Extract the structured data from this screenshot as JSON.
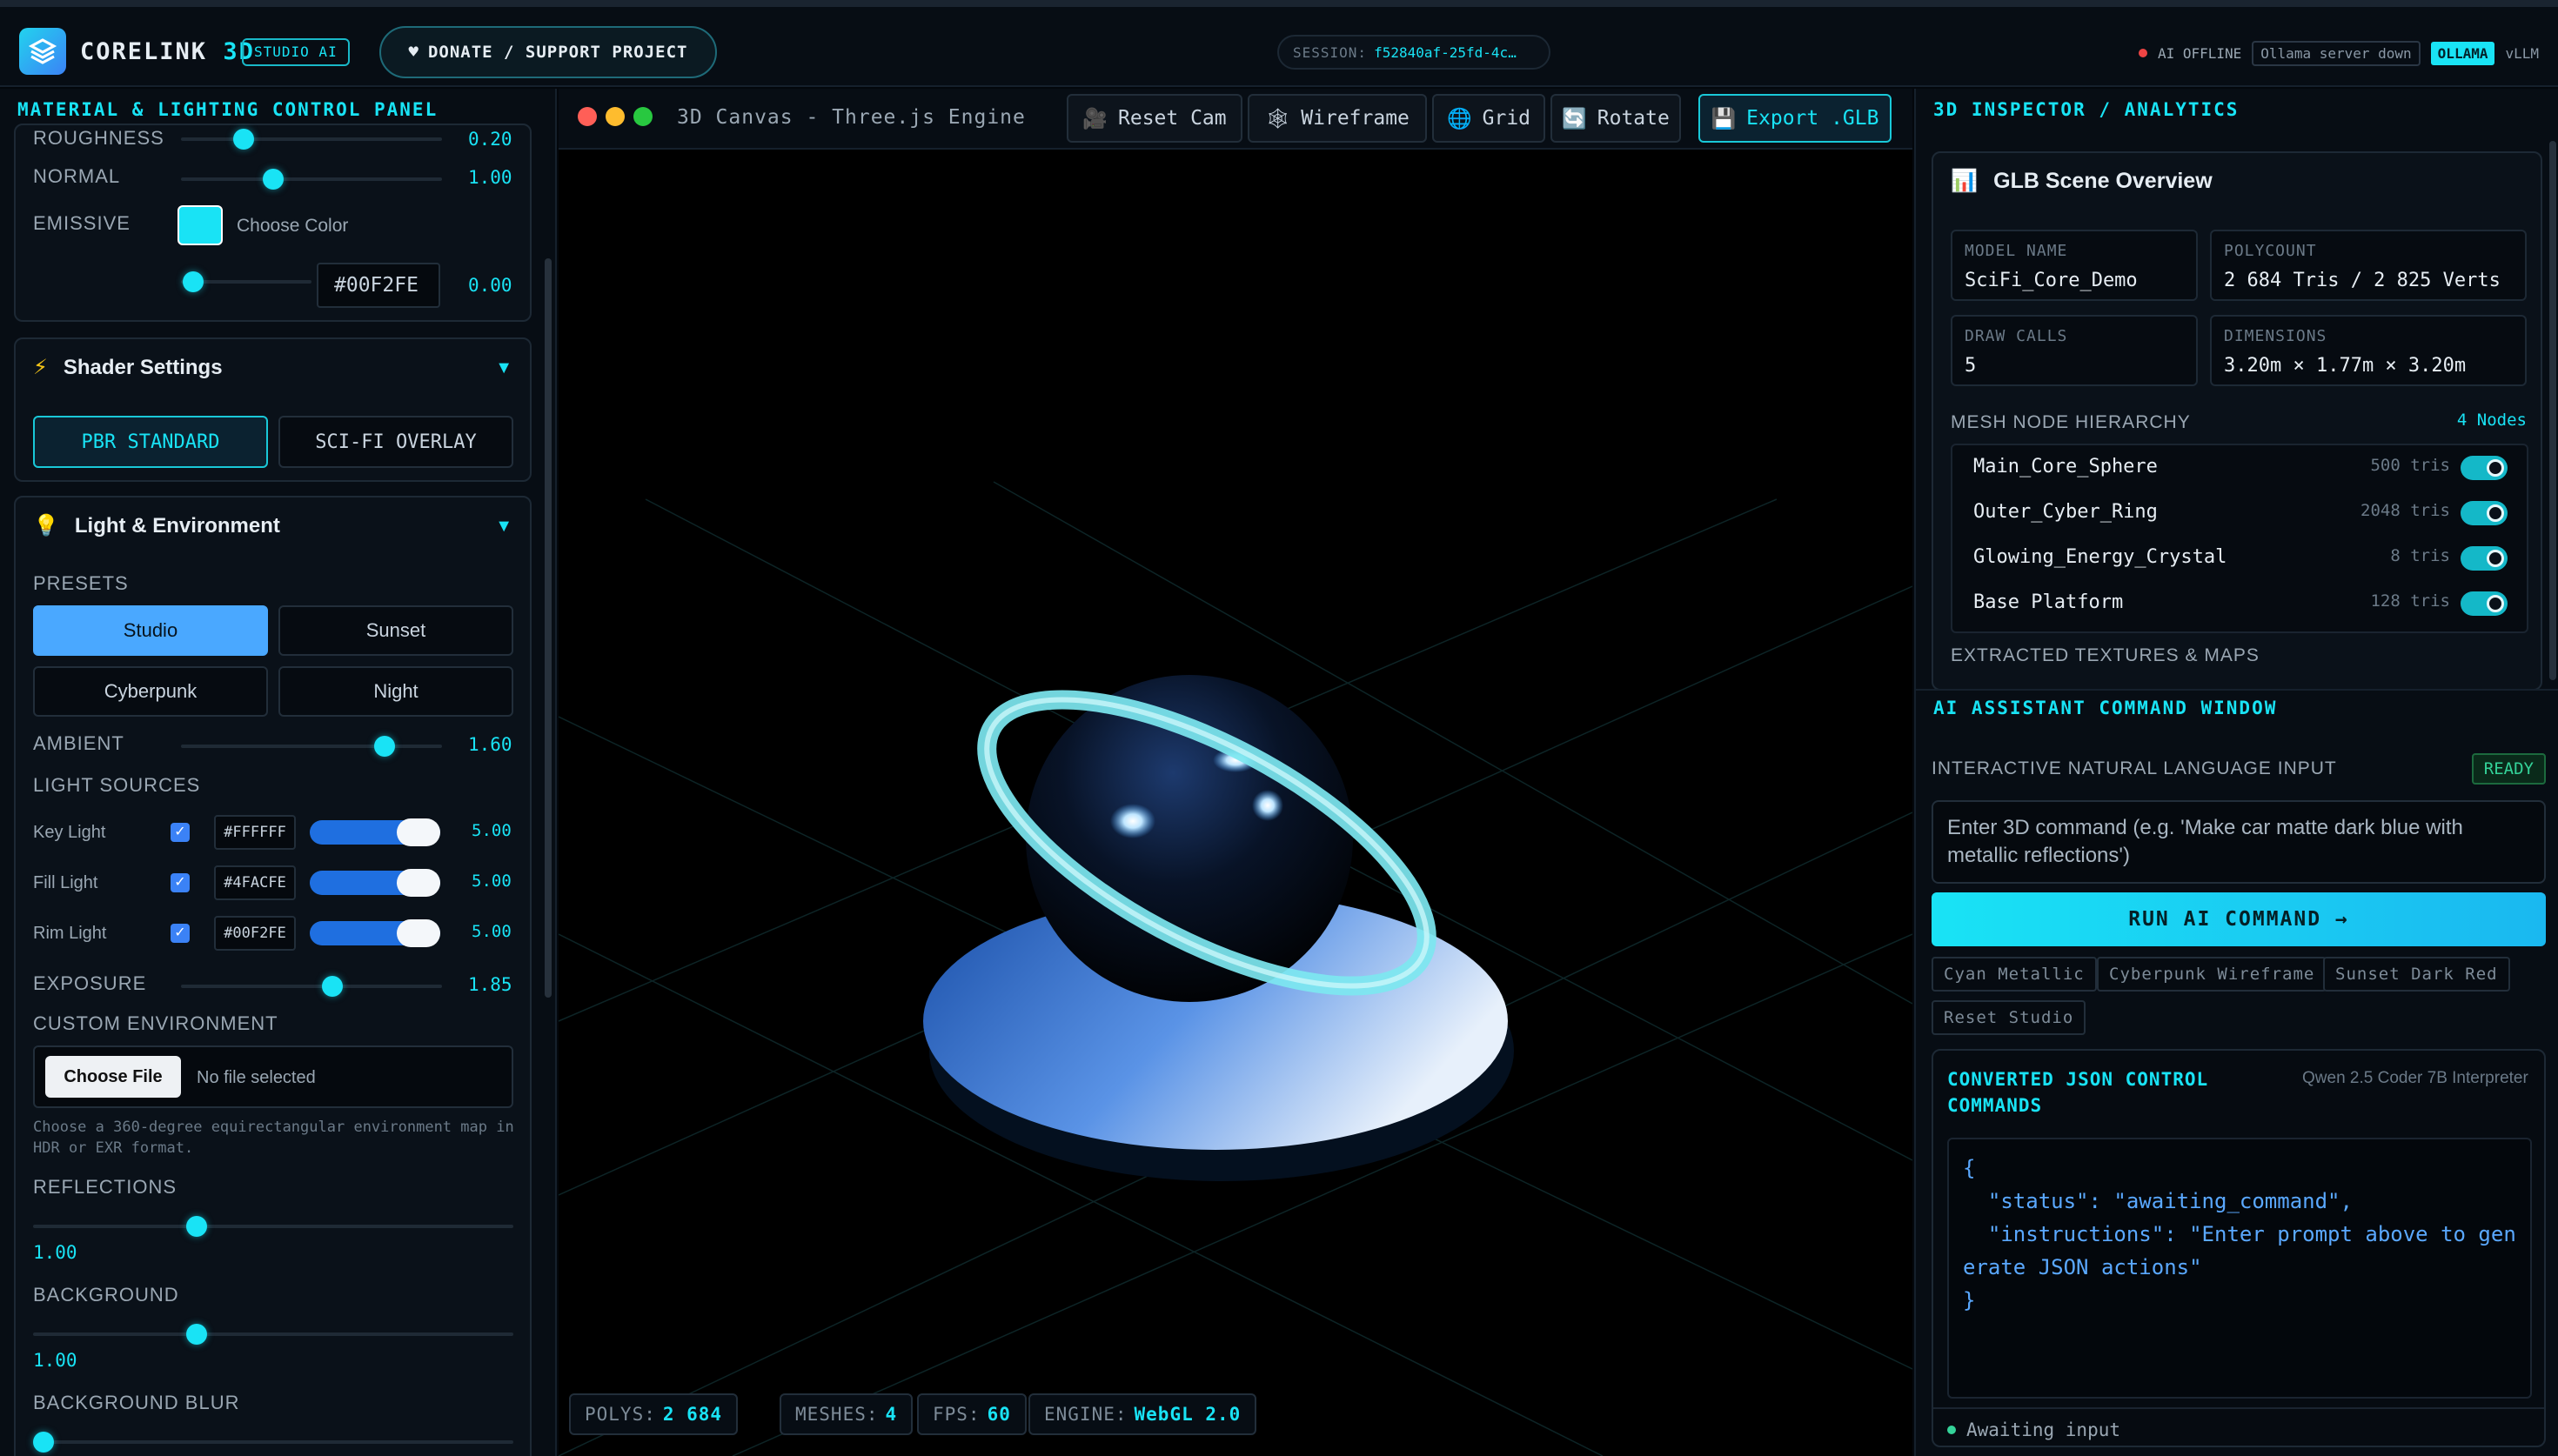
{
  "app": {
    "name_a": "CORELINK",
    "name_b": "3D",
    "badge": "STUDIO AI",
    "donate": "DONATE / SUPPORT PROJECT",
    "heart": "♥"
  },
  "session": {
    "label": "SESSION:",
    "value": "f52840af-25fd-4c…"
  },
  "status": {
    "ai": "AI OFFLINE",
    "note": "Ollama server down",
    "ollama": "OLLAMA",
    "vllm": "vLLM",
    "dot_color": "#ef4444"
  },
  "left": {
    "title": "MATERIAL & LIGHTING CONTROL PANEL",
    "material": {
      "roughness_label": "ROUGHNESS",
      "roughness_value": "0.20",
      "normal_label": "NORMAL",
      "normal_value": "1.00",
      "normal_level": 0.35,
      "emissive_label": "EMISSIVE",
      "choose_color": "Choose Color",
      "emissive_hex": "#00F2FE",
      "emissive_value": "0.00",
      "emissive_color": "#19e3f5"
    },
    "shader": {
      "title": "Shader Settings",
      "icon": "⚡",
      "opt1": "PBR STANDARD",
      "opt2": "SCI-FI OVERLAY"
    },
    "light": {
      "title": "Light & Environment",
      "icon": "💡",
      "presets_label": "PRESETS",
      "presets": [
        "Studio",
        "Sunset",
        "Cyberpunk",
        "Night"
      ],
      "ambient_label": "AMBIENT",
      "ambient_value": "1.60",
      "sources_label": "LIGHT SOURCES",
      "sources": [
        {
          "name": "Key Light",
          "hex": "#FFFFFF",
          "value": "5.00"
        },
        {
          "name": "Fill Light",
          "hex": "#4FACFE",
          "value": "5.00"
        },
        {
          "name": "Rim Light",
          "hex": "#00F2FE",
          "value": "5.00"
        }
      ],
      "exposure_label": "EXPOSURE",
      "exposure_value": "1.85",
      "custom_env_label": "CUSTOM ENVIRONMENT",
      "choose_file": "Choose File",
      "no_file": "No file selected",
      "env_note": "Choose a 360-degree equirectangular environment map in HDR or EXR format.",
      "reflections_label": "REFLECTIONS",
      "reflections_value": "1.00",
      "background_label": "BACKGROUND",
      "background_value": "1.00",
      "blur_label": "BACKGROUND BLUR"
    }
  },
  "canvas": {
    "title": "3D Canvas - Three.js Engine",
    "buttons": {
      "reset": "Reset Cam",
      "wireframe": "Wireframe",
      "grid": "Grid",
      "rotate": "Rotate",
      "export": "Export .GLB"
    },
    "stats": {
      "polys_label": "POLYS:",
      "polys": "2 684",
      "meshes_label": "MESHES:",
      "meshes": "4",
      "fps_label": "FPS:",
      "fps": "60",
      "engine_label": "ENGINE:",
      "engine": "WebGL 2.0"
    }
  },
  "right": {
    "title": "3D INSPECTOR / ANALYTICS",
    "overview_title": "GLB Scene Overview",
    "model_name_label": "MODEL NAME",
    "model_name": "SciFi_Core_Demo",
    "polycount_label": "POLYCOUNT",
    "polycount": "2 684 Tris / 2 825 Verts",
    "draw_calls_label": "DRAW CALLS",
    "draw_calls": "5",
    "dimensions_label": "DIMENSIONS",
    "dimensions": "3.20m × 1.77m × 3.20m",
    "hierarchy_label": "MESH NODE HIERARCHY",
    "node_count": "4 Nodes",
    "nodes": [
      {
        "name": "Main_Core_Sphere",
        "tris": "500 tris"
      },
      {
        "name": "Outer_Cyber_Ring",
        "tris": "2048 tris"
      },
      {
        "name": "Glowing_Energy_Crystal",
        "tris": "8 tris"
      },
      {
        "name": "Base Platform",
        "tris": "128 tris"
      }
    ],
    "textures_label": "EXTRACTED TEXTURES & MAPS",
    "ai_title": "AI ASSISTANT COMMAND WINDOW",
    "ai_input_label": "INTERACTIVE NATURAL LANGUAGE INPUT",
    "ready": "READY",
    "ai_placeholder": "Enter 3D command (e.g. 'Make car matte dark blue with metallic reflections')",
    "run_btn": "RUN AI COMMAND →",
    "chips": [
      "Cyan Metallic",
      "Cyberpunk Wireframe",
      "Sunset Dark Red",
      "Reset Studio"
    ],
    "json_title": "CONVERTED JSON CONTROL COMMANDS",
    "json_model": "Qwen 2.5 Coder 7B Interpreter",
    "json_text": "{\n  \"status\": \"awaiting_command\",\n  \"instructions\": \"Enter prompt above to generate JSON actions\"\n}",
    "awaiting": "Awaiting input"
  }
}
